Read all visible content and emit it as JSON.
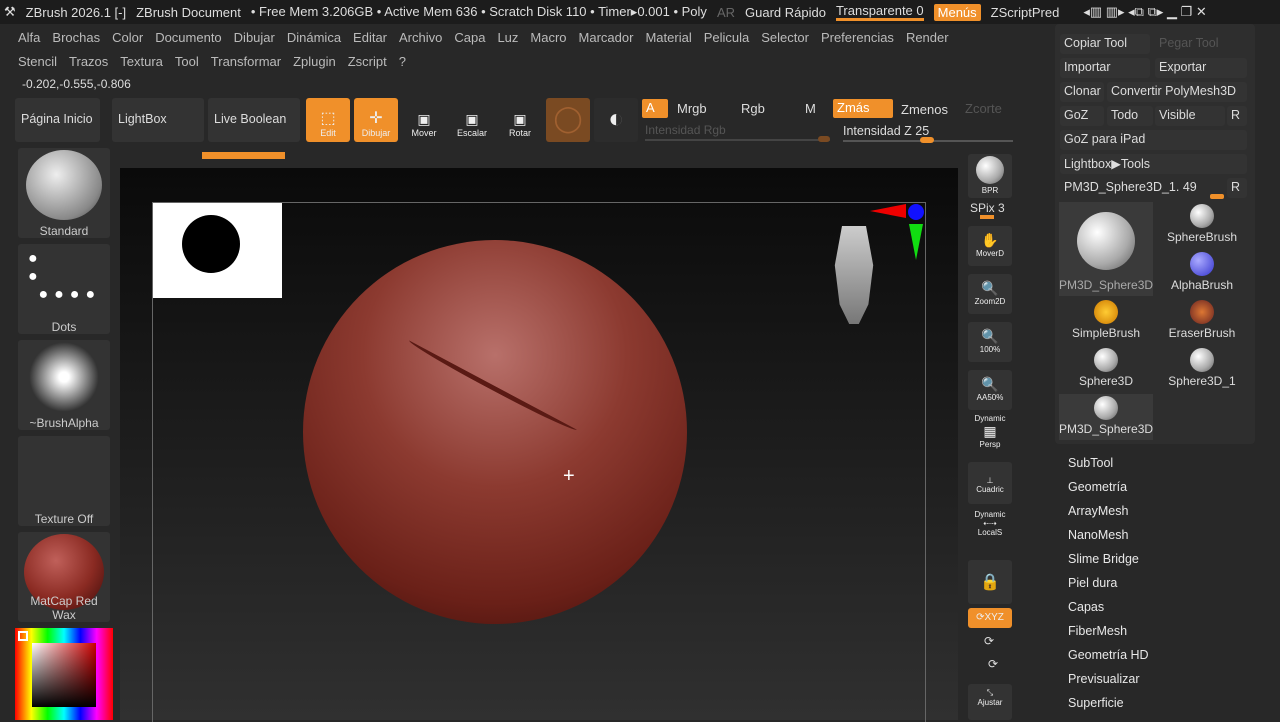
{
  "titlebar": {
    "app": "ZBrush 2026.1 [-]",
    "doc": "ZBrush Document",
    "stats": "• Free Mem 3.206GB • Active Mem 636 • Scratch Disk 110 • Timer▸0.001 • Poly",
    "ar": "AR",
    "guard": "Guard Rápido",
    "transparent": "Transparente 0",
    "menus": "Menús",
    "zscript": "ZScriptPred"
  },
  "menu_row1": [
    "Alfa",
    "Brochas",
    "Color",
    "Documento",
    "Dibujar",
    "Dinámica",
    "Editar",
    "Archivo",
    "Capa",
    "Luz",
    "Macro",
    "Marcador",
    "Material",
    "Pelicula",
    "Selector",
    "Preferencias",
    "Render"
  ],
  "menu_row2": [
    "Stencil",
    "Trazos",
    "Textura",
    "Tool",
    "Transformar",
    "Zplugin",
    "Zscript",
    "?"
  ],
  "coords": "-0.202,-0.555,-0.806",
  "toolbar": {
    "home": "Página Inicio",
    "lightbox": "LightBox",
    "live_boolean": "Live Boolean",
    "edit": "Edit",
    "draw": "Dibujar",
    "move": "Mover",
    "scale": "Escalar",
    "rotate": "Rotar",
    "a": "A",
    "mrgb": "Mrgb",
    "rgb": "Rgb",
    "m": "M",
    "zadd": "Zmás",
    "zsub": "Zmenos",
    "zcut": "Zcorte",
    "rgb_intensity": "Intensidad Rgb",
    "z_intensity": "Intensidad Z 25"
  },
  "left_shelf": [
    "Standard",
    "Dots",
    "~BrushAlpha",
    "Texture Off",
    "MatCap Red Wax"
  ],
  "right_shelf": {
    "bpr": "BPR",
    "spix": "SPix 3",
    "move": "MoverD",
    "zoom": "Zoom2D",
    "actual": "100%",
    "aa": "AA50%",
    "dynamic": "Dynamic",
    "persp": "Persp",
    "floor": "Cuadric",
    "local": "LocalS",
    "xyz": "XYZ",
    "frame": "Ajustar"
  },
  "tool_panel": {
    "copy": "Copiar Tool",
    "paste": "Pegar Tool",
    "import": "Importar",
    "export": "Exportar",
    "clone": "Clonar",
    "convert": "Convertir PolyMesh3D",
    "goz": "GoZ",
    "all": "Todo",
    "visible": "Visible",
    "r": "R",
    "goz_ipad": "GoZ para iPad",
    "lightbox_tools": "Lightbox▶Tools",
    "current": "PM3D_Sphere3D_1. 49",
    "tools": [
      "PM3D_Sphere3D",
      "SphereBrush",
      "AlphaBrush",
      "SimpleBrush",
      "EraserBrush",
      "Sphere3D",
      "Sphere3D_1",
      "PM3D_Sphere3D"
    ]
  },
  "subpalettes": [
    "SubTool",
    "Geometría",
    "ArrayMesh",
    "NanoMesh",
    "Slime Bridge",
    "Piel dura",
    "Capas",
    "FiberMesh",
    "Geometría HD",
    "Previsualizar",
    "Superficie"
  ],
  "colors": {
    "accent": "#f0902a",
    "material": "#8a2a22"
  }
}
